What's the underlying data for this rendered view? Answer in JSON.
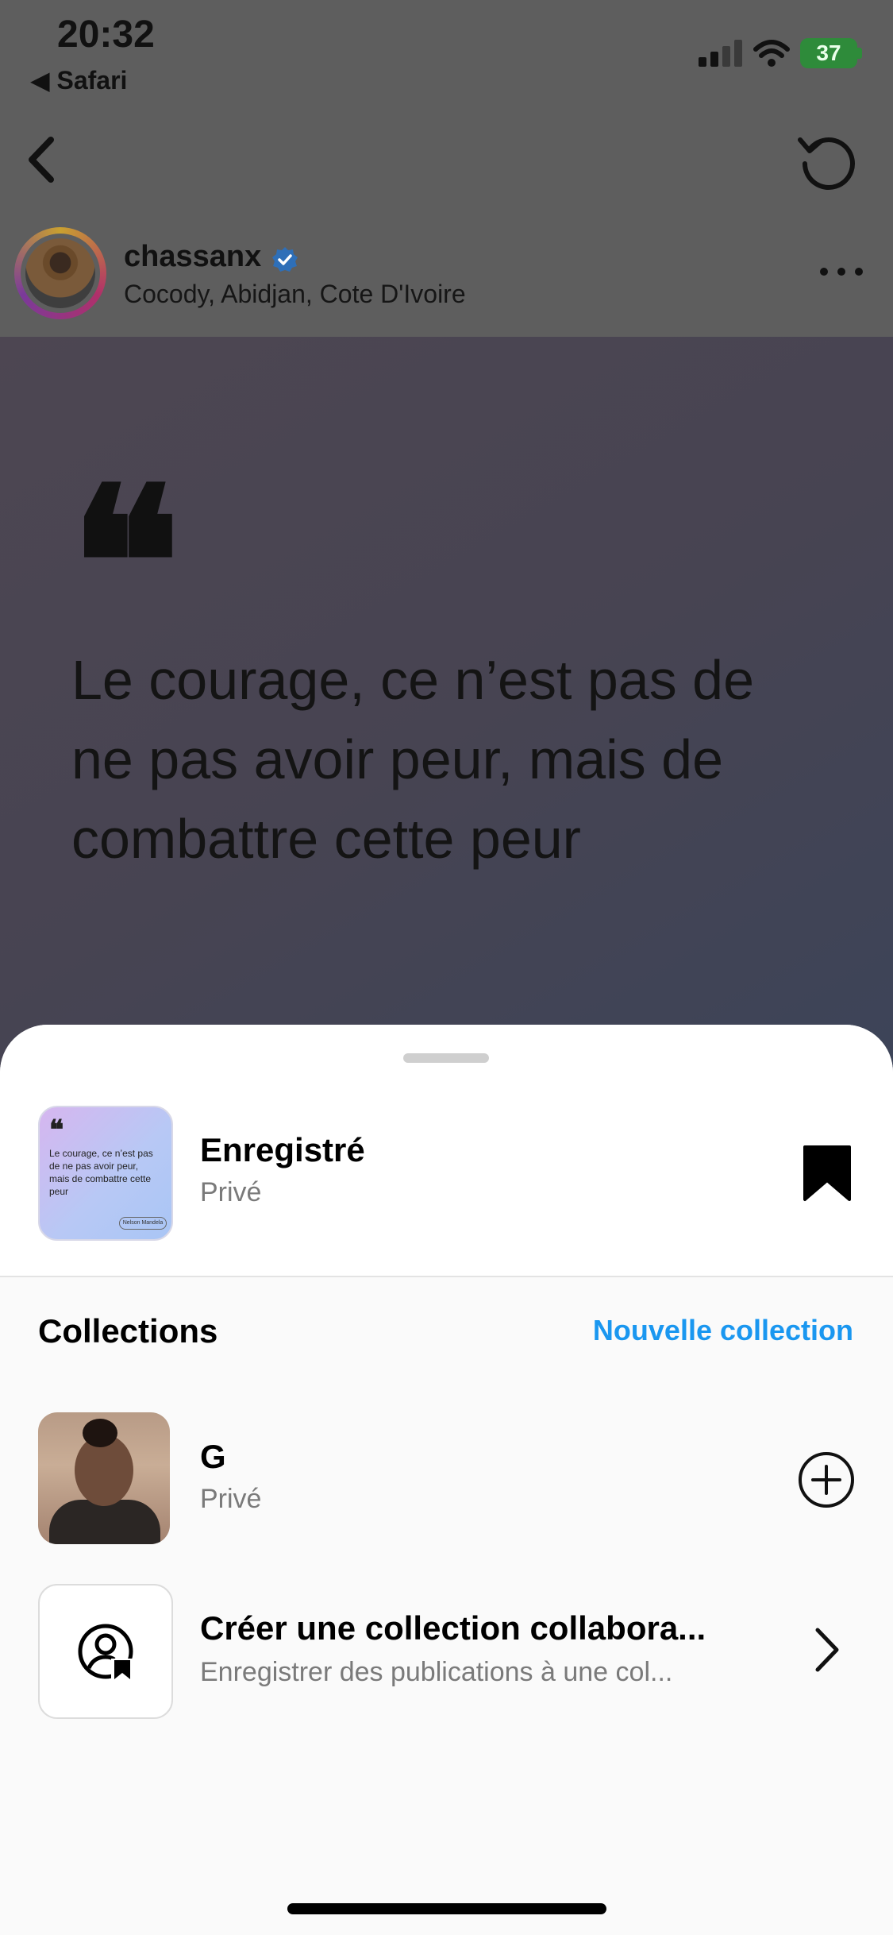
{
  "status_bar": {
    "time": "20:32",
    "back_app": "◀ Safari",
    "battery": "37"
  },
  "post": {
    "username": "chassanx",
    "location": "Cocody, Abidjan, Cote D'Ivoire",
    "quote_mark": "❝",
    "quote_text": "Le courage, ce n’est pas de ne pas avoir peur, mais de combattre cette peur"
  },
  "sheet": {
    "saved": {
      "title": "Enregistré",
      "subtitle": "Privé",
      "thumb_quote": "❝",
      "thumb_text": "Le courage, ce n’est pas de ne pas avoir peur, mais de combattre cette peur",
      "thumb_author": "Nelson Mandela"
    },
    "collections_title": "Collections",
    "new_collection_label": "Nouvelle collection",
    "collections": [
      {
        "title": "G",
        "subtitle": "Privé"
      },
      {
        "title": "Créer une collection collabora...",
        "subtitle": "Enregistrer des publications à une col..."
      }
    ]
  },
  "colors": {
    "accent": "#1a97f0",
    "battery": "#2e8b3a"
  },
  "icons": [
    "back-chevron-icon",
    "refresh-icon",
    "verified-badge-icon",
    "more-dots-icon",
    "bookmark-filled-icon",
    "plus-circle-icon",
    "collab-user-bookmark-icon",
    "chevron-right-icon"
  ]
}
